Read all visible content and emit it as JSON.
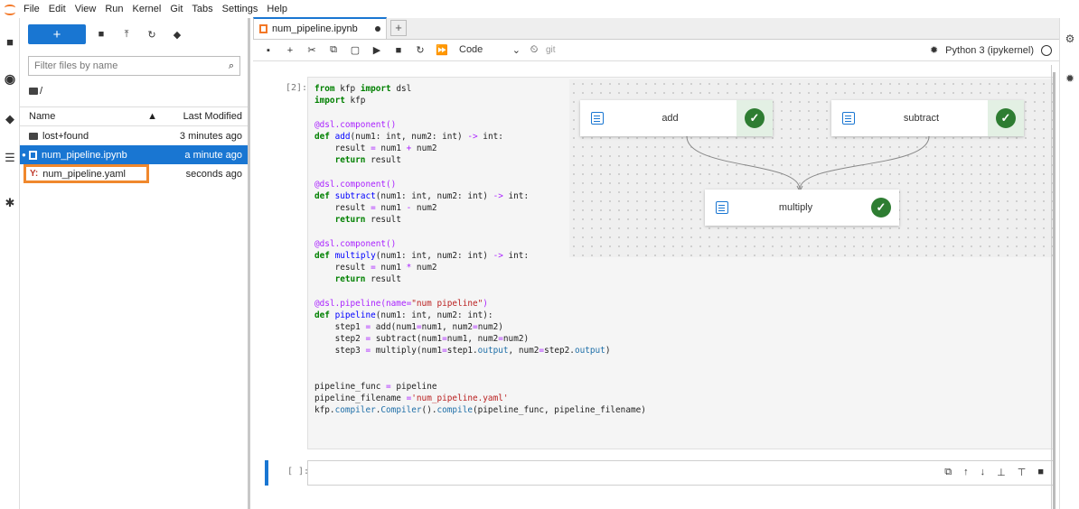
{
  "menubar": {
    "items": [
      "File",
      "Edit",
      "View",
      "Run",
      "Kernel",
      "Git",
      "Tabs",
      "Settings",
      "Help"
    ]
  },
  "filebrowser": {
    "new_label": "+",
    "filter_placeholder": "Filter files by name",
    "breadcrumb": "/",
    "col_name": "Name",
    "col_modified": "Last Modified",
    "files": [
      {
        "name": "lost+found",
        "modified": "3 minutes ago",
        "type": "folder"
      },
      {
        "name": "num_pipeline.ipynb",
        "modified": "a minute ago",
        "type": "notebook",
        "selected": true
      },
      {
        "name": "num_pipeline.yaml",
        "modified": "seconds ago",
        "type": "yaml",
        "highlighted": true
      }
    ],
    "yaml_prefix": "Y:"
  },
  "tab": {
    "title": "num_pipeline.ipynb",
    "add_label": "+"
  },
  "toolbar": {
    "cell_type": "Code",
    "git_label": "git",
    "kernel": "Python 3 (ipykernel)"
  },
  "cell1": {
    "prompt": "[2]:"
  },
  "cell2": {
    "prompt": "[ ]:"
  },
  "pipeline": {
    "nodes": [
      {
        "label": "add"
      },
      {
        "label": "subtract"
      },
      {
        "label": "multiply"
      }
    ]
  },
  "code": {
    "l1_a": "from",
    "l1_b": " kfp ",
    "l1_c": "import",
    "l1_d": " dsl",
    "l2_a": "import",
    "l2_b": " kfp",
    "l4": "@dsl.component()",
    "l5_a": "def",
    "l5_b": " ",
    "l5_c": "add",
    "l5_d": "(num1: int, num2: int) ",
    "l5_e": "->",
    "l5_f": " int:",
    "l6_a": "    result ",
    "l6_b": "=",
    "l6_c": " num1 ",
    "l6_d": "+",
    "l6_e": " num2",
    "l7_a": "    ",
    "l7_b": "return",
    "l7_c": " result",
    "l9": "@dsl.component()",
    "l10_a": "def",
    "l10_b": " ",
    "l10_c": "subtract",
    "l10_d": "(num1: int, num2: int) ",
    "l10_e": "->",
    "l10_f": " int:",
    "l11_a": "    result ",
    "l11_b": "=",
    "l11_c": " num1 ",
    "l11_d": "-",
    "l11_e": " num2",
    "l12_a": "    ",
    "l12_b": "return",
    "l12_c": " result",
    "l14": "@dsl.component()",
    "l15_a": "def",
    "l15_b": " ",
    "l15_c": "multiply",
    "l15_d": "(num1: int, num2: int) ",
    "l15_e": "->",
    "l15_f": " int:",
    "l16_a": "    result ",
    "l16_b": "=",
    "l16_c": " num1 ",
    "l16_d": "*",
    "l16_e": " num2",
    "l17_a": "    ",
    "l17_b": "return",
    "l17_c": " result",
    "l19_a": "@dsl.pipeline(name=",
    "l19_b": "\"num pipeline\"",
    "l19_c": ")",
    "l20_a": "def",
    "l20_b": " ",
    "l20_c": "pipeline",
    "l20_d": "(num1: int, num2: int):",
    "l21_a": "    step1 ",
    "l21_b": "=",
    "l21_c": " add(num1",
    "l21_d": "=",
    "l21_e": "num1, num2",
    "l21_f": "=",
    "l21_g": "num2)",
    "l22_a": "    step2 ",
    "l22_b": "=",
    "l22_c": " subtract(num1",
    "l22_d": "=",
    "l22_e": "num1, num2",
    "l22_f": "=",
    "l22_g": "num2)",
    "l23_a": "    step3 ",
    "l23_b": "=",
    "l23_c": " multiply(num1",
    "l23_d": "=",
    "l23_e": "step1.",
    "l23_f": "output",
    "l23_g": ", num2",
    "l23_h": "=",
    "l23_i": "step2.",
    "l23_j": "output",
    "l23_k": ")",
    "l26_a": "pipeline_func ",
    "l26_b": "=",
    "l26_c": " pipeline",
    "l27_a": "pipeline_filename ",
    "l27_b": "=",
    "l27_c": "'num_pipeline.yaml'",
    "l28_a": "kfp.",
    "l28_b": "compiler",
    "l28_c": ".",
    "l28_d": "Compiler",
    "l28_e": "().",
    "l28_f": "compile",
    "l28_g": "(pipeline_func, pipeline_filename)"
  },
  "colors": {
    "accent": "#1976d2",
    "highlight_box": "#f0882d",
    "success": "#2e7d32"
  }
}
